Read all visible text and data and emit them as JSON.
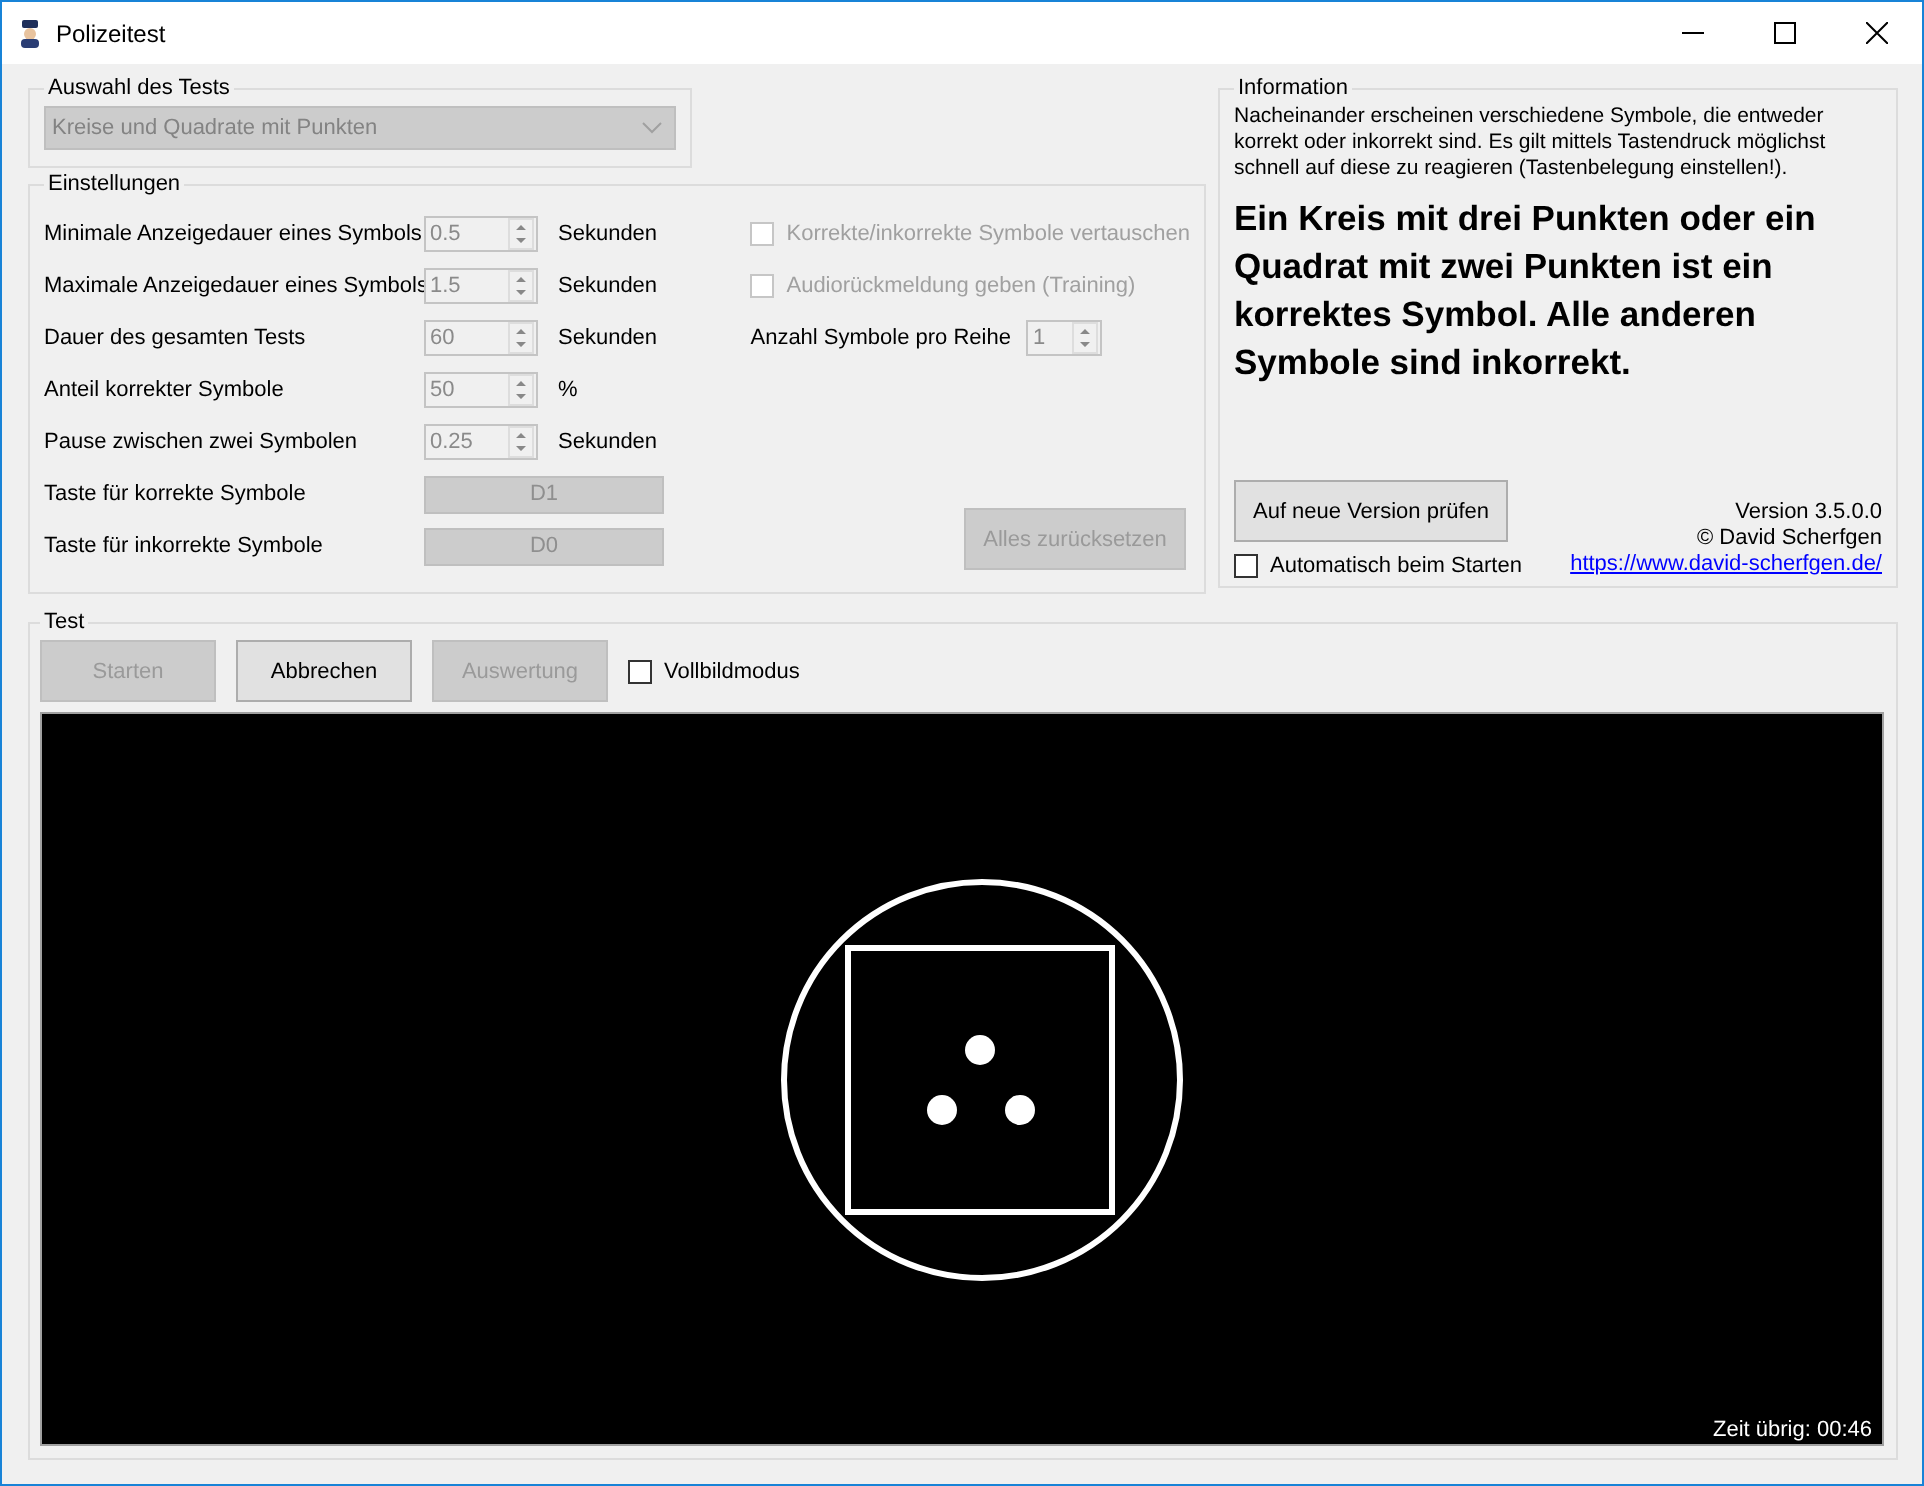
{
  "window": {
    "title": "Polizeitest"
  },
  "test_selection": {
    "title": "Auswahl des Tests",
    "value": "Kreise und Quadrate mit Punkten",
    "disabled": true
  },
  "settings": {
    "title": "Einstellungen",
    "spinners": [
      {
        "label": "Minimale Anzeigedauer eines Symbols",
        "value": "0.5",
        "unit": "Sekunden",
        "disabled": true
      },
      {
        "label": "Maximale Anzeigedauer eines Symbols",
        "value": "1.5",
        "unit": "Sekunden",
        "disabled": true
      },
      {
        "label": "Dauer des gesamten Tests",
        "value": "60",
        "unit": "Sekunden",
        "disabled": true
      },
      {
        "label": "Anteil korrekter Symbole",
        "value": "50",
        "unit": "%",
        "disabled": true
      },
      {
        "label": "Pause zwischen zwei Symbolen",
        "value": "0.25",
        "unit": "Sekunden",
        "disabled": true
      }
    ],
    "keys": [
      {
        "label": "Taste für korrekte Symbole",
        "value": "D1",
        "disabled": true
      },
      {
        "label": "Taste für inkorrekte Symbole",
        "value": "D0",
        "disabled": true
      }
    ],
    "checkboxes": [
      {
        "label": "Korrekte/inkorrekte Symbole vertauschen",
        "checked": false,
        "disabled": true
      },
      {
        "label": "Audiorückmeldung geben (Training)",
        "checked": false,
        "disabled": true
      }
    ],
    "symbols_per_row": {
      "label": "Anzahl Symbole pro Reihe",
      "value": "1",
      "disabled": true
    },
    "reset_button": {
      "label": "Alles zurücksetzen",
      "disabled": true
    }
  },
  "information": {
    "title": "Information",
    "description": "Nacheinander erscheinen verschiedene Symbole, die entweder korrekt oder inkorrekt sind. Es gilt mittels Tastendruck möglichst schnell auf diese zu reagieren (Tastenbelegung einstellen!).",
    "rule": "Ein Kreis mit drei Punkten oder ein Quadrat mit zwei Punkten ist ein korrektes Symbol. Alle anderen Symbole sind inkorrekt.",
    "update_button": {
      "label": "Auf neue Version prüfen",
      "disabled": false
    },
    "auto_check": {
      "label": "Automatisch beim Starten",
      "checked": false
    },
    "version": "Version 3.5.0.0",
    "copyright": "© David Scherfgen",
    "link": "https://www.david-scherfgen.de/"
  },
  "test": {
    "title": "Test",
    "buttons": [
      {
        "label": "Starten",
        "disabled": true
      },
      {
        "label": "Abbrechen",
        "disabled": false
      },
      {
        "label": "Auswertung",
        "disabled": true
      }
    ],
    "fullscreen": {
      "label": "Vollbildmodus",
      "checked": false
    },
    "time_left": "Zeit übrig: 00:46"
  }
}
